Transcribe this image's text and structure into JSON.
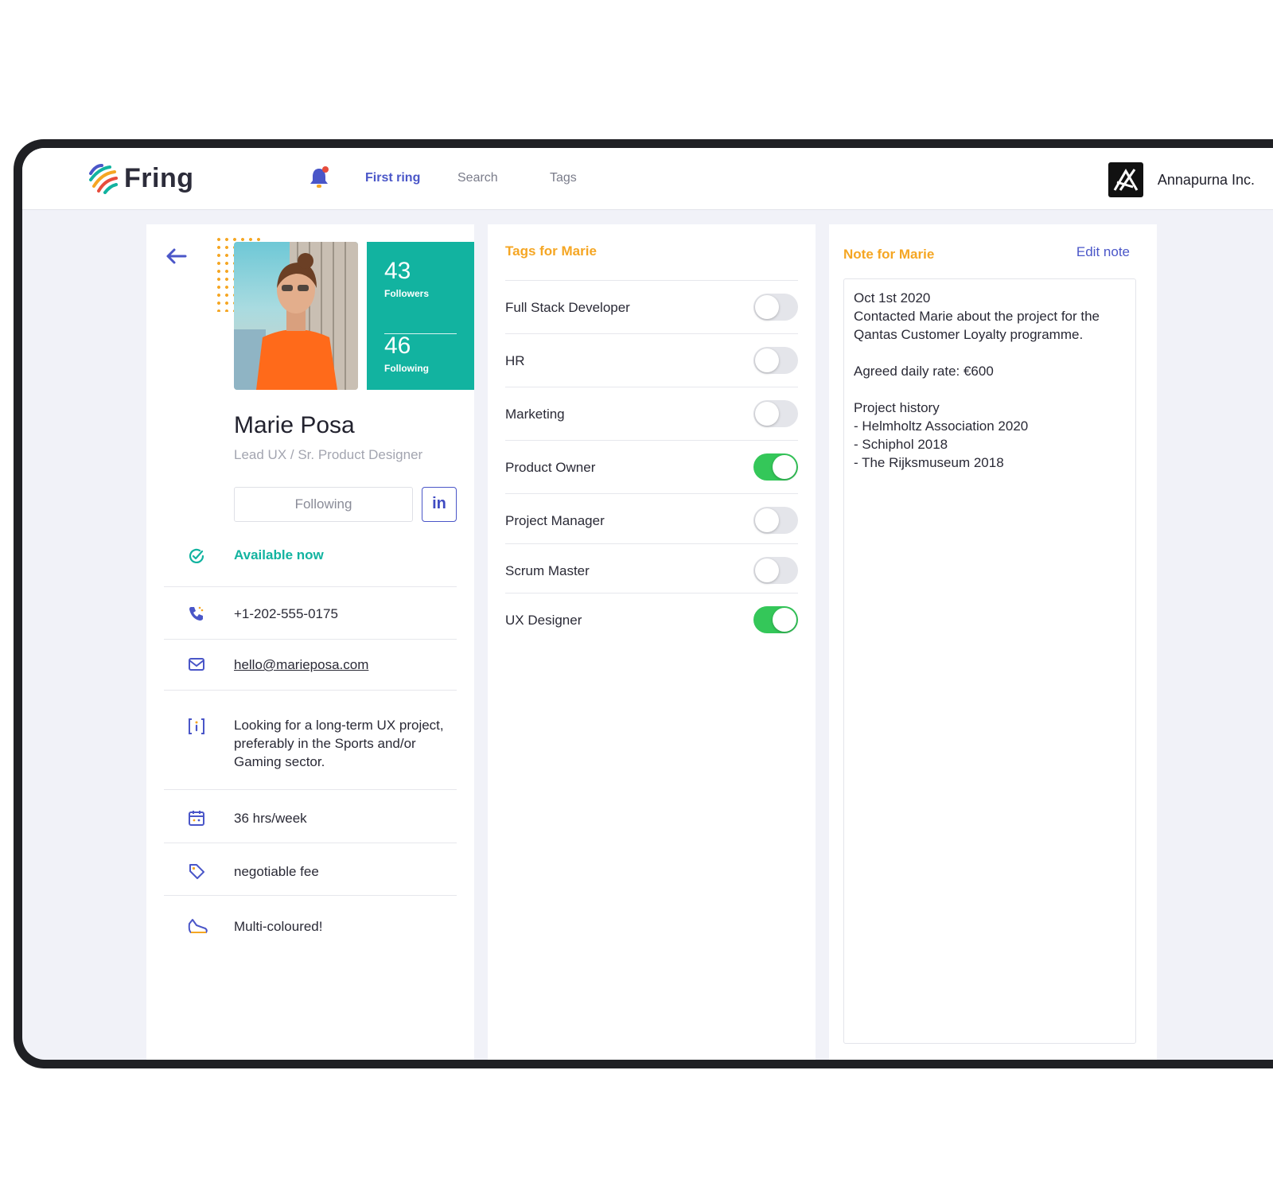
{
  "app": {
    "name": "Fring"
  },
  "nav": {
    "items": [
      {
        "label": "First ring",
        "active": true
      },
      {
        "label": "Search",
        "active": false
      },
      {
        "label": "Tags",
        "active": false
      }
    ]
  },
  "company": {
    "name": "Annapurna Inc."
  },
  "profile": {
    "followers_count": "43",
    "followers_label": "Followers",
    "following_count": "46",
    "following_label": "Following",
    "name": "Marie Posa",
    "title": "Lead UX / Sr. Product Designer",
    "follow_button": "Following",
    "linkedin_label": "in",
    "availability": "Available now",
    "phone": "+1-202-555-0175",
    "email": "hello@marieposa.com",
    "about": "Looking for a long-term UX project, preferably in the Sports and/or Gaming sector.",
    "hours": "36 hrs/week",
    "fee": "negotiable fee",
    "style": "Multi-coloured!"
  },
  "tags": {
    "title": "Tags for Marie",
    "items": [
      {
        "label": "Full Stack Developer",
        "on": false
      },
      {
        "label": "HR",
        "on": false
      },
      {
        "label": "Marketing",
        "on": false
      },
      {
        "label": "Product Owner",
        "on": true
      },
      {
        "label": "Project Manager",
        "on": false
      },
      {
        "label": "Scrum Master",
        "on": false
      },
      {
        "label": "UX Designer",
        "on": true
      }
    ]
  },
  "note": {
    "title": "Note for Marie",
    "edit_label": "Edit note",
    "body": "Oct 1st 2020\nContacted Marie about the project for the Qantas Customer Loyalty programme.\n\nAgreed daily rate: €600\n\nProject history\n- Helmholtz Association 2020\n- Schiphol 2018\n- The Rijksmuseum 2018"
  },
  "colors": {
    "accent": "#4a56c8",
    "teal": "#12b3a0",
    "orange": "#f5a623",
    "toggle_on": "#34c759"
  }
}
